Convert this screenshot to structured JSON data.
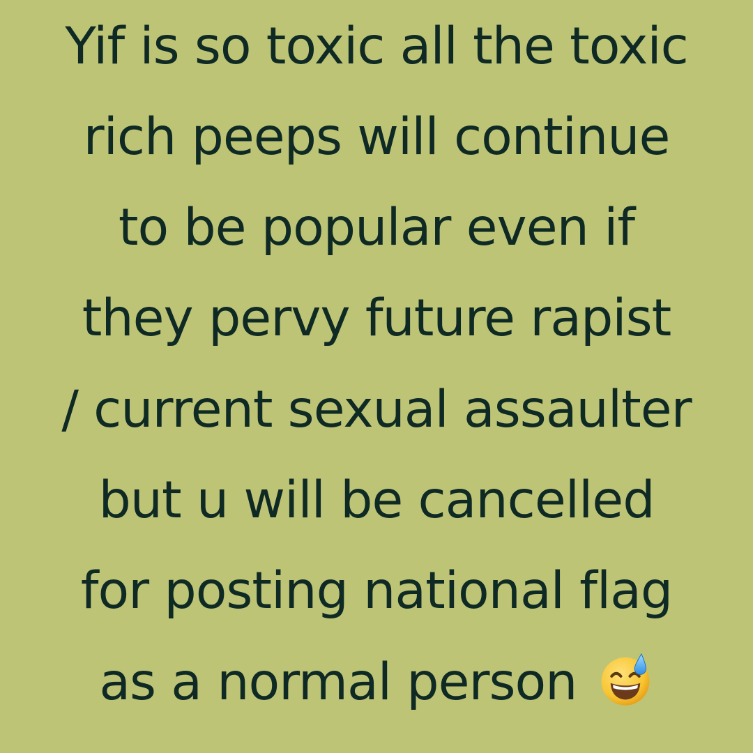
{
  "post": {
    "lines": [
      "Yif is so toxic all the toxic",
      "rich peeps will continue",
      "to be popular even if",
      "they pervy future rapist",
      "/ current sexual assaulter",
      "but u will be cancelled",
      "for posting national flag",
      "as a normal person"
    ],
    "emoji": "grinning-face-with-sweat-icon"
  },
  "colors": {
    "background": "#bec476",
    "text": "#0f2a24"
  }
}
